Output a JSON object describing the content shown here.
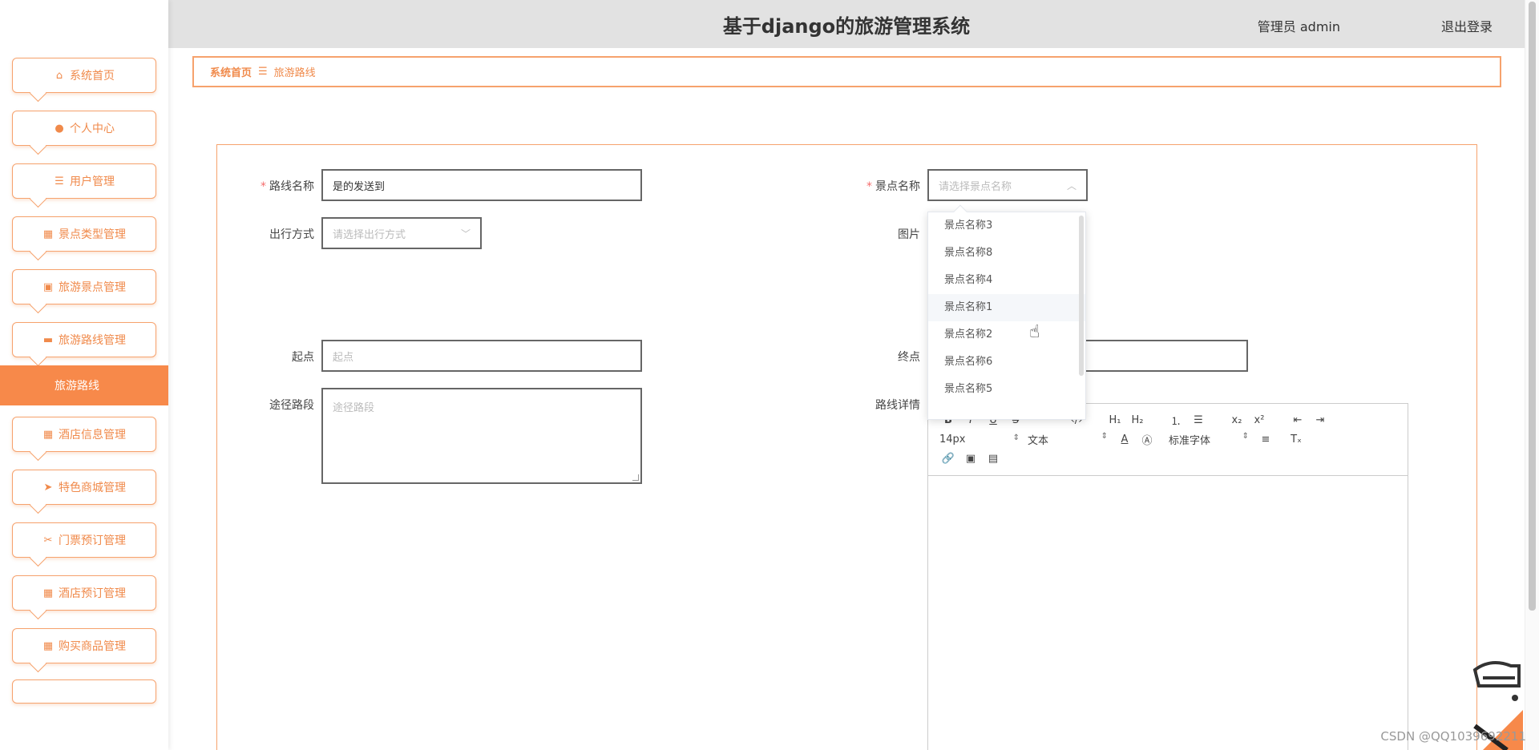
{
  "header": {
    "title": "基于django的旅游管理系统",
    "admin_text": "管理员 admin",
    "logout": "退出登录"
  },
  "sidebar": {
    "items": [
      {
        "label": "系统首页",
        "icon": "home-icon"
      },
      {
        "label": "个人中心",
        "icon": "user-icon"
      },
      {
        "label": "用户管理",
        "icon": "list-icon"
      },
      {
        "label": "景点类型管理",
        "icon": "grid-icon"
      },
      {
        "label": "旅游景点管理",
        "icon": "clipboard-icon"
      },
      {
        "label": "旅游路线管理",
        "icon": "message-icon"
      },
      {
        "label": "酒店信息管理",
        "icon": "grid-icon"
      },
      {
        "label": "特色商城管理",
        "icon": "send-icon"
      },
      {
        "label": "门票预订管理",
        "icon": "ticket-icon"
      },
      {
        "label": "酒店预订管理",
        "icon": "table-icon"
      },
      {
        "label": "购买商品管理",
        "icon": "grid-icon"
      }
    ],
    "active_sub": "旅游路线"
  },
  "breadcrumb": {
    "home": "系统首页",
    "separator": "☰",
    "current": "旅游路线"
  },
  "form": {
    "route_name": {
      "label": "路线名称",
      "value": "是的发送到"
    },
    "spot_name": {
      "label": "景点名称",
      "placeholder": "请选择景点名称"
    },
    "travel_mode": {
      "label": "出行方式",
      "placeholder": "请选择出行方式"
    },
    "image": {
      "label": "图片"
    },
    "start": {
      "label": "起点",
      "placeholder": "起点"
    },
    "end": {
      "label": "终点"
    },
    "waypoints": {
      "label": "途径路段",
      "placeholder": "途径路段"
    },
    "details": {
      "label": "路线详情"
    }
  },
  "dropdown": {
    "options": [
      "景点名称3",
      "景点名称8",
      "景点名称4",
      "景点名称1",
      "景点名称2",
      "景点名称6",
      "景点名称5"
    ],
    "hovered": "景点名称1"
  },
  "editor": {
    "font_size": "14px",
    "text_type": "文本",
    "font_family": "标准字体"
  },
  "watermark": "CSDN @QQ1039692211",
  "colors": {
    "accent": "#f7894a",
    "border_accent": "#f6a26d",
    "header_bg": "#e2e2e2"
  }
}
